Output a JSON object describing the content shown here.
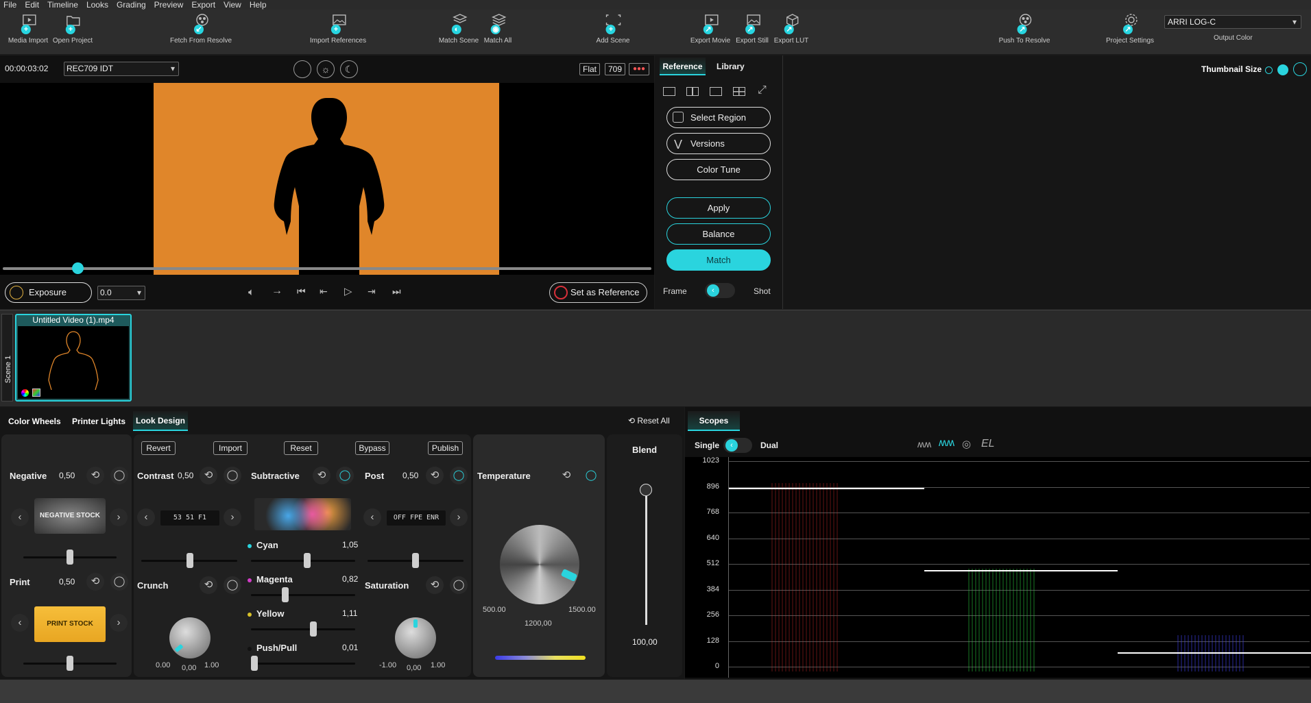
{
  "menu": [
    "File",
    "Edit",
    "Timeline",
    "Looks",
    "Grading",
    "Preview",
    "Export",
    "View",
    "Help"
  ],
  "toolbar": {
    "media_import": "Media Import",
    "open_project": "Open Project",
    "fetch_resolve": "Fetch From Resolve",
    "import_refs": "Import References",
    "match_scene": "Match Scene",
    "match_all": "Match All",
    "add_scene": "Add Scene",
    "export_movie": "Export Movie",
    "export_still": "Export Still",
    "export_lut": "Export LUT",
    "push_resolve": "Push To Resolve",
    "project_settings": "Project Settings",
    "output_color_value": "ARRI LOG-C",
    "output_color_label": "Output Color"
  },
  "viewer": {
    "timecode": "00:00:03:02",
    "idt": "REC709 IDT",
    "flat": "Flat",
    "rec": "709",
    "exposure_label": "Exposure",
    "exposure_value": "0.0",
    "set_reference": "Set as Reference",
    "playhead_fraction": 0.115,
    "frame_color": "#e0862a"
  },
  "reference": {
    "tab_reference": "Reference",
    "tab_library": "Library",
    "thumbnail_size": "Thumbnail Size",
    "select_region": "Select Region",
    "versions": "Versions",
    "color_tune": "Color Tune",
    "apply": "Apply",
    "balance": "Balance",
    "match": "Match",
    "frame": "Frame",
    "shot": "Shot"
  },
  "scenes": {
    "scene_label": "Scene 1",
    "clip_name": "Untitled Video (1).mp4"
  },
  "grading": {
    "tabs": [
      "Color Wheels",
      "Printer Lights",
      "Look Design"
    ],
    "reset_all": "Reset All",
    "actions": [
      "Revert",
      "Import",
      "Reset",
      "Bypass",
      "Publish"
    ],
    "negative": {
      "label": "Negative",
      "value": "0,50",
      "stock": "NEGATIVE STOCK"
    },
    "print": {
      "label": "Print",
      "value": "0,50",
      "stock": "PRINT STOCK"
    },
    "contrast": {
      "label": "Contrast",
      "value": "0,50",
      "display": "53 51 F1"
    },
    "crunch": {
      "label": "Crunch",
      "min": "0.00",
      "value": "0,00",
      "max": "1.00"
    },
    "subtractive": {
      "label": "Subtractive"
    },
    "cyan": {
      "label": "Cyan",
      "value": "1,05"
    },
    "magenta": {
      "label": "Magenta",
      "value": "0,82"
    },
    "yellow": {
      "label": "Yellow",
      "value": "1,11"
    },
    "pushpull": {
      "label": "Push/Pull",
      "value": "0,01"
    },
    "post": {
      "label": "Post",
      "value": "0,50",
      "display": "OFF FPE ENR"
    },
    "saturation": {
      "label": "Saturation",
      "min": "-1.00",
      "value": "0,00",
      "max": "1.00"
    },
    "temperature": {
      "label": "Temperature",
      "min": "500.00",
      "value": "1200,00",
      "max": "1500.00"
    },
    "blend": {
      "label": "Blend",
      "value": "100,00"
    }
  },
  "scopes": {
    "tab": "Scopes",
    "single": "Single",
    "dual": "Dual",
    "mode_el": "EL",
    "ticks": [
      "1023",
      "896",
      "768",
      "640",
      "512",
      "384",
      "256",
      "128",
      "0"
    ]
  }
}
